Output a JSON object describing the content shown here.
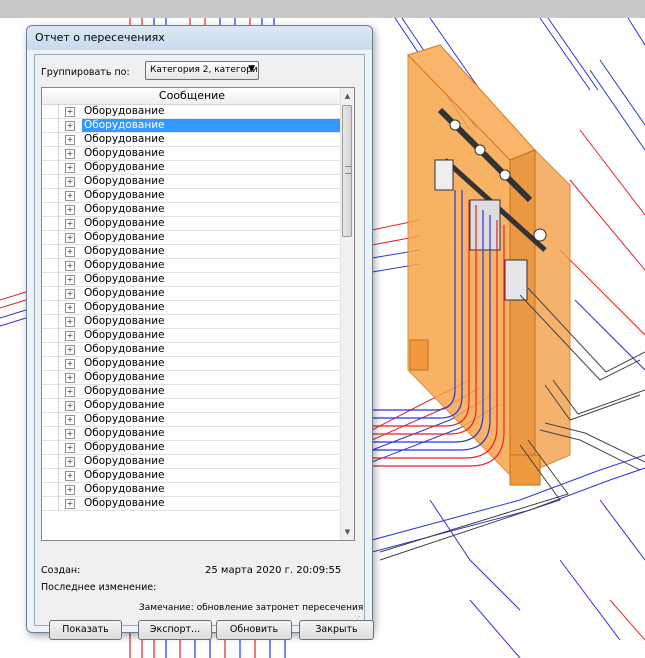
{
  "dialog": {
    "title": "Отчет о пересечениях",
    "group_by": {
      "label": "Группировать по:",
      "selected": "Категория 2, категори"
    },
    "list": {
      "column_header": "Сообщение",
      "rows": [
        {
          "label": "Оборудование",
          "selected": false
        },
        {
          "label": "Оборудование",
          "selected": true
        },
        {
          "label": "Оборудование",
          "selected": false
        },
        {
          "label": "Оборудование",
          "selected": false
        },
        {
          "label": "Оборудование",
          "selected": false
        },
        {
          "label": "Оборудование",
          "selected": false
        },
        {
          "label": "Оборудование",
          "selected": false
        },
        {
          "label": "Оборудование",
          "selected": false
        },
        {
          "label": "Оборудование",
          "selected": false
        },
        {
          "label": "Оборудование",
          "selected": false
        },
        {
          "label": "Оборудование",
          "selected": false
        },
        {
          "label": "Оборудование",
          "selected": false
        },
        {
          "label": "Оборудование",
          "selected": false
        },
        {
          "label": "Оборудование",
          "selected": false
        },
        {
          "label": "Оборудование",
          "selected": false
        },
        {
          "label": "Оборудование",
          "selected": false
        },
        {
          "label": "Оборудование",
          "selected": false
        },
        {
          "label": "Оборудование",
          "selected": false
        },
        {
          "label": "Оборудование",
          "selected": false
        },
        {
          "label": "Оборудование",
          "selected": false
        },
        {
          "label": "Оборудование",
          "selected": false
        },
        {
          "label": "Оборудование",
          "selected": false
        },
        {
          "label": "Оборудование",
          "selected": false
        },
        {
          "label": "Оборудование",
          "selected": false
        },
        {
          "label": "Оборудование",
          "selected": false
        },
        {
          "label": "Оборудование",
          "selected": false
        },
        {
          "label": "Оборудование",
          "selected": false
        },
        {
          "label": "Оборудование",
          "selected": false
        },
        {
          "label": "Оборудование",
          "selected": false
        }
      ]
    },
    "created_label": "Создан:",
    "created_value": "25 марта 2020 г. 20:09:55",
    "modified_label": "Последнее изменение:",
    "note": "Замечание: обновление затронет пересечения из этого спи",
    "buttons": {
      "show": "Показать",
      "export": "Экспорт...",
      "refresh": "Обновить",
      "close": "Закрыть"
    }
  },
  "viewport": {
    "cabinet_color": "#f7a54a",
    "pipe_red": "#e0262a",
    "pipe_blue": "#2b36d8"
  },
  "icons": {
    "expand": "plus-box-icon",
    "dropdown": "triangle-down-icon",
    "scroll_up": "triangle-up-icon",
    "scroll_down": "triangle-down-icon",
    "resize": "resize-grip-icon"
  }
}
